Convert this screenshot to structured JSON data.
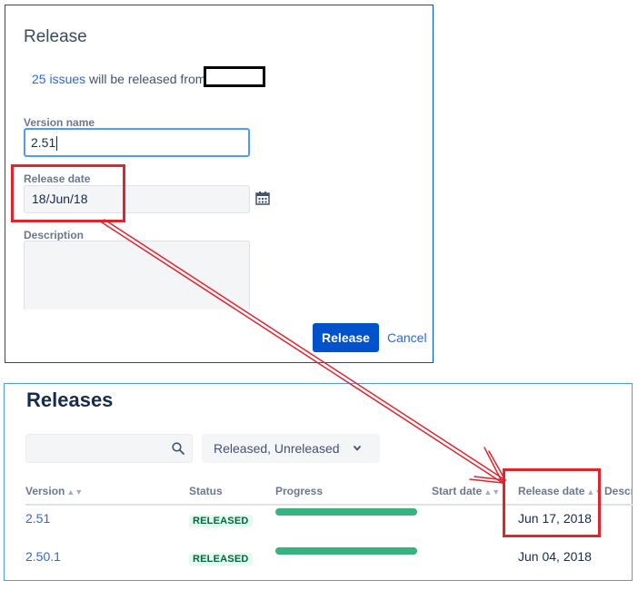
{
  "dialog": {
    "title": "Release",
    "summary": {
      "issues_link": "25 issues",
      "text": " will be released from"
    },
    "version_name": {
      "label": "Version name",
      "value": "2.51"
    },
    "release_date": {
      "label": "Release date",
      "value": "18/Jun/18"
    },
    "description": {
      "label": "Description",
      "value": ""
    },
    "release_button": "Release",
    "cancel_link": "Cancel"
  },
  "releases": {
    "title": "Releases",
    "search": {
      "placeholder": ""
    },
    "filter": {
      "label": "Released, Unreleased"
    },
    "columns": {
      "version": "Version",
      "status": "Status",
      "progress": "Progress",
      "start_date": "Start date",
      "release_date": "Release date",
      "description": "Descr"
    },
    "rows": [
      {
        "version": "2.51",
        "status": "RELEASED",
        "progress": 1.0,
        "start_date": "",
        "release_date": "Jun 17, 2018"
      },
      {
        "version": "2.50.1",
        "status": "RELEASED",
        "progress": 1.0,
        "start_date": "",
        "release_date": "Jun 04, 2018"
      }
    ]
  },
  "colors": {
    "primary": "#0052cc",
    "link": "#2a6bd2",
    "annotation": "#e3232c",
    "progress": "#36b37e",
    "released_badge_bg": "#e3fcef",
    "released_badge_text": "#006644"
  }
}
